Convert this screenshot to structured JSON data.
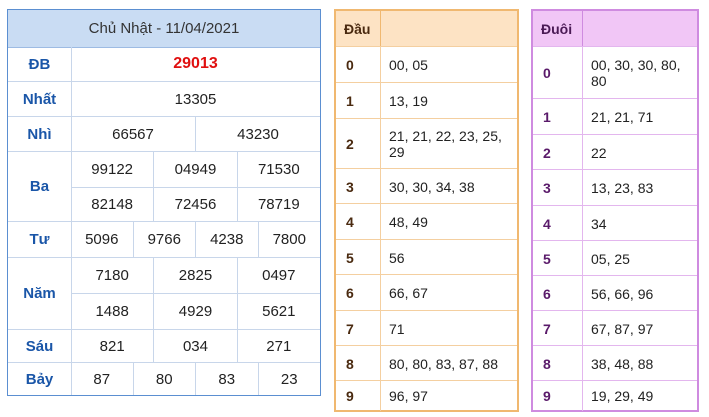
{
  "results": {
    "title": "Chủ Nhật - 11/04/2021",
    "prizes": {
      "db": {
        "label": "ĐB",
        "values": [
          "29013"
        ]
      },
      "nhat": {
        "label": "Nhất",
        "values": [
          "13305"
        ]
      },
      "nhi": {
        "label": "Nhì",
        "values": [
          "66567",
          "43230"
        ]
      },
      "ba": {
        "label": "Ba",
        "values": [
          "99122",
          "04949",
          "71530",
          "82148",
          "72456",
          "78719"
        ]
      },
      "tu": {
        "label": "Tư",
        "values": [
          "5096",
          "9766",
          "4238",
          "7800"
        ]
      },
      "nam": {
        "label": "Năm",
        "values": [
          "7180",
          "2825",
          "0497",
          "1488",
          "4929",
          "5621"
        ]
      },
      "sau": {
        "label": "Sáu",
        "values": [
          "821",
          "034",
          "271"
        ]
      },
      "bay": {
        "label": "Bảy",
        "values": [
          "87",
          "80",
          "83",
          "23"
        ]
      }
    }
  },
  "dau": {
    "header": "Đầu",
    "rows": [
      {
        "k": "0",
        "v": "00, 05"
      },
      {
        "k": "1",
        "v": "13, 19"
      },
      {
        "k": "2",
        "v": "21, 21, 22, 23, 25, 29"
      },
      {
        "k": "3",
        "v": "30, 30, 34, 38"
      },
      {
        "k": "4",
        "v": "48, 49"
      },
      {
        "k": "5",
        "v": "56"
      },
      {
        "k": "6",
        "v": "66, 67"
      },
      {
        "k": "7",
        "v": "71"
      },
      {
        "k": "8",
        "v": "80, 80, 83, 87, 88"
      },
      {
        "k": "9",
        "v": "96, 97"
      }
    ]
  },
  "duoi": {
    "header": "Đuôi",
    "rows": [
      {
        "k": "0",
        "v": "00, 30, 30, 80, 80"
      },
      {
        "k": "1",
        "v": "21, 21, 71"
      },
      {
        "k": "2",
        "v": "22"
      },
      {
        "k": "3",
        "v": "13, 23, 83"
      },
      {
        "k": "4",
        "v": "34"
      },
      {
        "k": "5",
        "v": "05, 25"
      },
      {
        "k": "6",
        "v": "56, 66, 96"
      },
      {
        "k": "7",
        "v": "67, 87, 97"
      },
      {
        "k": "8",
        "v": "38, 48, 88"
      },
      {
        "k": "9",
        "v": "19, 29, 49"
      }
    ]
  },
  "colors": {
    "special_prize": "#e01010",
    "prize_label": "#1a56a8",
    "results_header_bg": "#c9dcf3",
    "dau_header_bg": "#fde3c4",
    "duoi_header_bg": "#f1c6f6"
  }
}
